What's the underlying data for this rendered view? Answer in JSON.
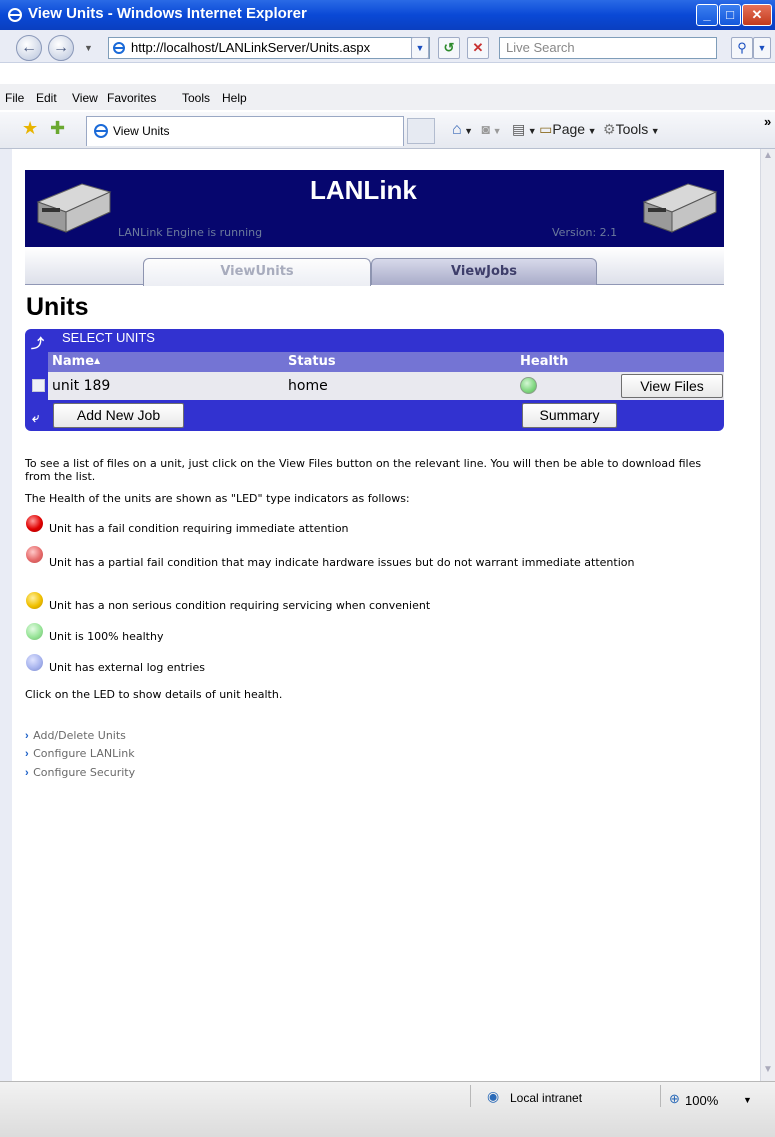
{
  "window": {
    "title": "View Units - Windows Internet Explorer",
    "minimize": "_",
    "maximize": "□",
    "close": "✕"
  },
  "browser": {
    "address": "http://localhost/LANLinkServer/Units.aspx",
    "search_placeholder": "Live Search",
    "menu": [
      "File",
      "Edit",
      "View",
      "Favorites",
      "Tools",
      "Help"
    ],
    "tab_title": "View Units",
    "page_menu": "Page",
    "tools_menu": "Tools"
  },
  "banner": {
    "title": "LANLink",
    "status": "LANLink Engine is running",
    "version": "Version: 2.1"
  },
  "tabs": [
    {
      "label": "ViewUnits",
      "active": true
    },
    {
      "label": "ViewJobs",
      "active": false
    }
  ],
  "page": {
    "heading": "Units"
  },
  "grid": {
    "caption": "SELECT UNITS",
    "columns": {
      "name": "Name",
      "status": "Status",
      "health": "Health"
    },
    "sort_indicator": "▲",
    "rows": [
      {
        "name": "unit 189",
        "status": "home",
        "health": "green",
        "action": "View Files"
      }
    ],
    "add_button": "Add New Job",
    "summary_button": "Summary"
  },
  "help": {
    "intro": "To see a list of files on a unit, just click on the View Files button on the relevant line. You will then be able to download files from the list.",
    "legend_intro": "The Health of the units are shown as \"LED\" type indicators as follows:",
    "legend": [
      {
        "color": "#e00000",
        "text": "Unit has a fail condition requiring immediate attention"
      },
      {
        "color": "#e66a6a",
        "text": "Unit has a partial fail condition that may indicate hardware issues but do not warrant immediate attention"
      },
      {
        "color": "#f0c000",
        "text": "Unit has a non serious condition requiring servicing when convenient"
      },
      {
        "color": "#98e498",
        "text": "Unit is 100% healthy"
      },
      {
        "color": "#a8b4ee",
        "text": "Unit has external log entries"
      }
    ],
    "click_hint": "Click on the LED to show details of unit health."
  },
  "links": [
    "Add/Delete Units",
    "Configure LANLink",
    "Configure Security"
  ],
  "status": {
    "zone": "Local intranet",
    "zoom": "100%"
  }
}
